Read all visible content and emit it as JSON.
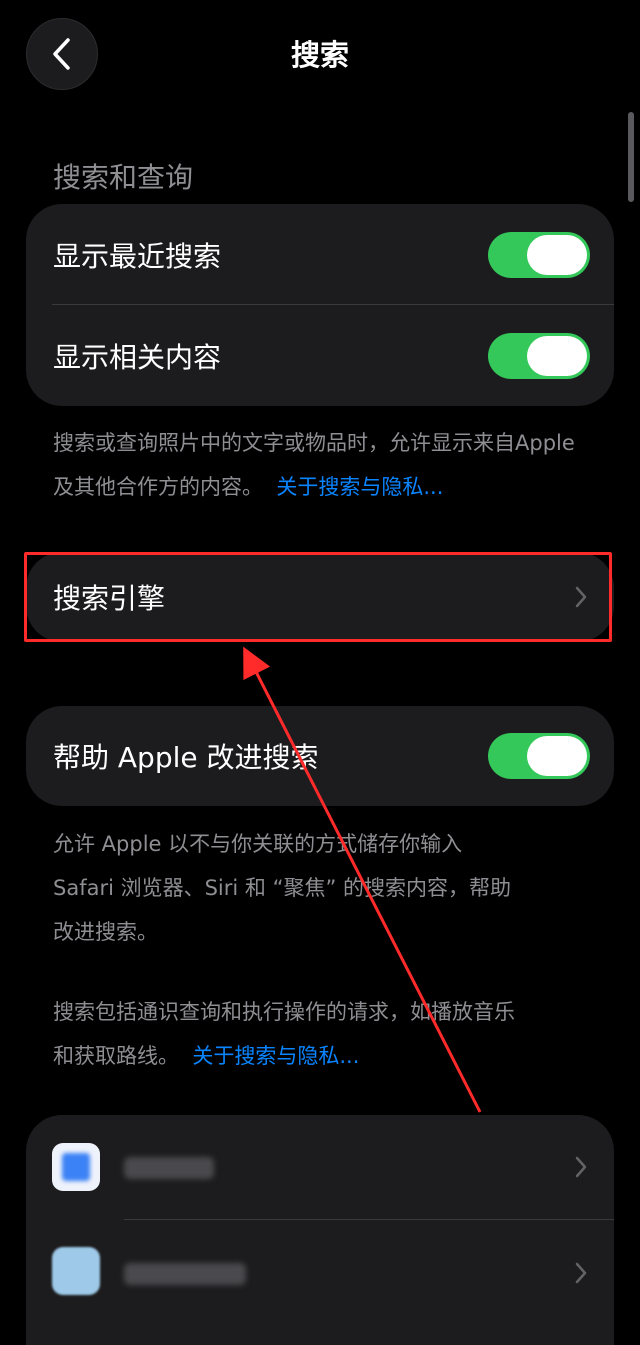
{
  "header": {
    "back_icon": "chevron-left-icon",
    "title": "搜索"
  },
  "search_section": {
    "header": "搜索和查询",
    "rows": [
      {
        "label": "显示最近搜索",
        "toggle_on": true
      },
      {
        "label": "显示相关内容",
        "toggle_on": true
      }
    ],
    "footnote_text": "搜索或查询照片中的文字或物品时，允许显示来自Apple 及其他合作方的内容。",
    "footnote_link": "关于搜索与隐私..."
  },
  "search_engine": {
    "label": "搜索引擎",
    "chevron_icon": "chevron-right-icon"
  },
  "improve_section": {
    "row_label": "帮助 Apple 改进搜索",
    "toggle_on": true,
    "footnote_line1": "允许 Apple 以不与你关联的方式储存你输入",
    "footnote_line2": "Safari 浏览器、Siri 和 “聚焦” 的搜索内容，帮助",
    "footnote_line3": "改进搜索。",
    "footnote2_line1": "搜索包括通识查询和执行操作的请求，如播放音乐",
    "footnote2_text": "和获取路线。",
    "footnote2_link": "关于搜索与隐私..."
  },
  "apps_list": {
    "items": [
      {
        "icon": "app-icon-blurred",
        "label_blurred": true
      },
      {
        "icon": "app-icon-blurred",
        "label_blurred": true
      }
    ]
  },
  "colors": {
    "background": "#000000",
    "card": "#1c1c1e",
    "toggle_on": "#34c759",
    "link": "#0a84ff",
    "annotation": "#ff2b2b"
  }
}
